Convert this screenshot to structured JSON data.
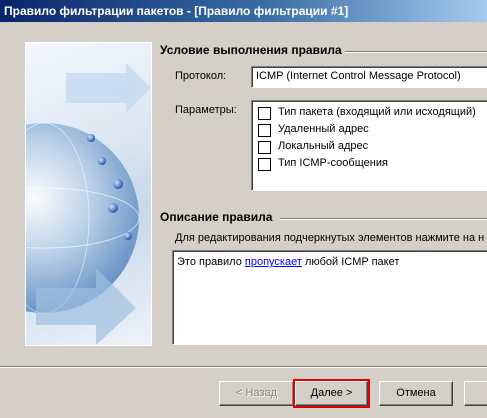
{
  "window": {
    "title": "Правило фильтрации пакетов - [Правило фильтрации #1]"
  },
  "condition": {
    "heading": "Условие выполнения правила",
    "protocol_label": "Протокол:",
    "protocol_value": "ICMP (Internet Control Message Protocol)",
    "params_label": "Параметры:",
    "params": [
      {
        "label": "Тип пакета (входящий или исходящий)",
        "checked": false
      },
      {
        "label": "Удаленный адрес",
        "checked": false
      },
      {
        "label": "Локальный адрес",
        "checked": false
      },
      {
        "label": "Тип ICMP-сообщения",
        "checked": false
      }
    ]
  },
  "description": {
    "heading": "Описание правила",
    "hint": "Для редактирования подчеркнутых элементов нажмите на н",
    "text_before": "Это правило ",
    "link": "пропускает",
    "text_after": " любой ICMP пакет"
  },
  "buttons": {
    "back": "< Назад",
    "next": "Далее >",
    "cancel": "Отмена"
  },
  "colors": {
    "titlebar_start": "#0a246a",
    "titlebar_end": "#a6caf0",
    "face": "#d4d0c8",
    "link": "#0000ff",
    "highlight": "#e00000"
  }
}
